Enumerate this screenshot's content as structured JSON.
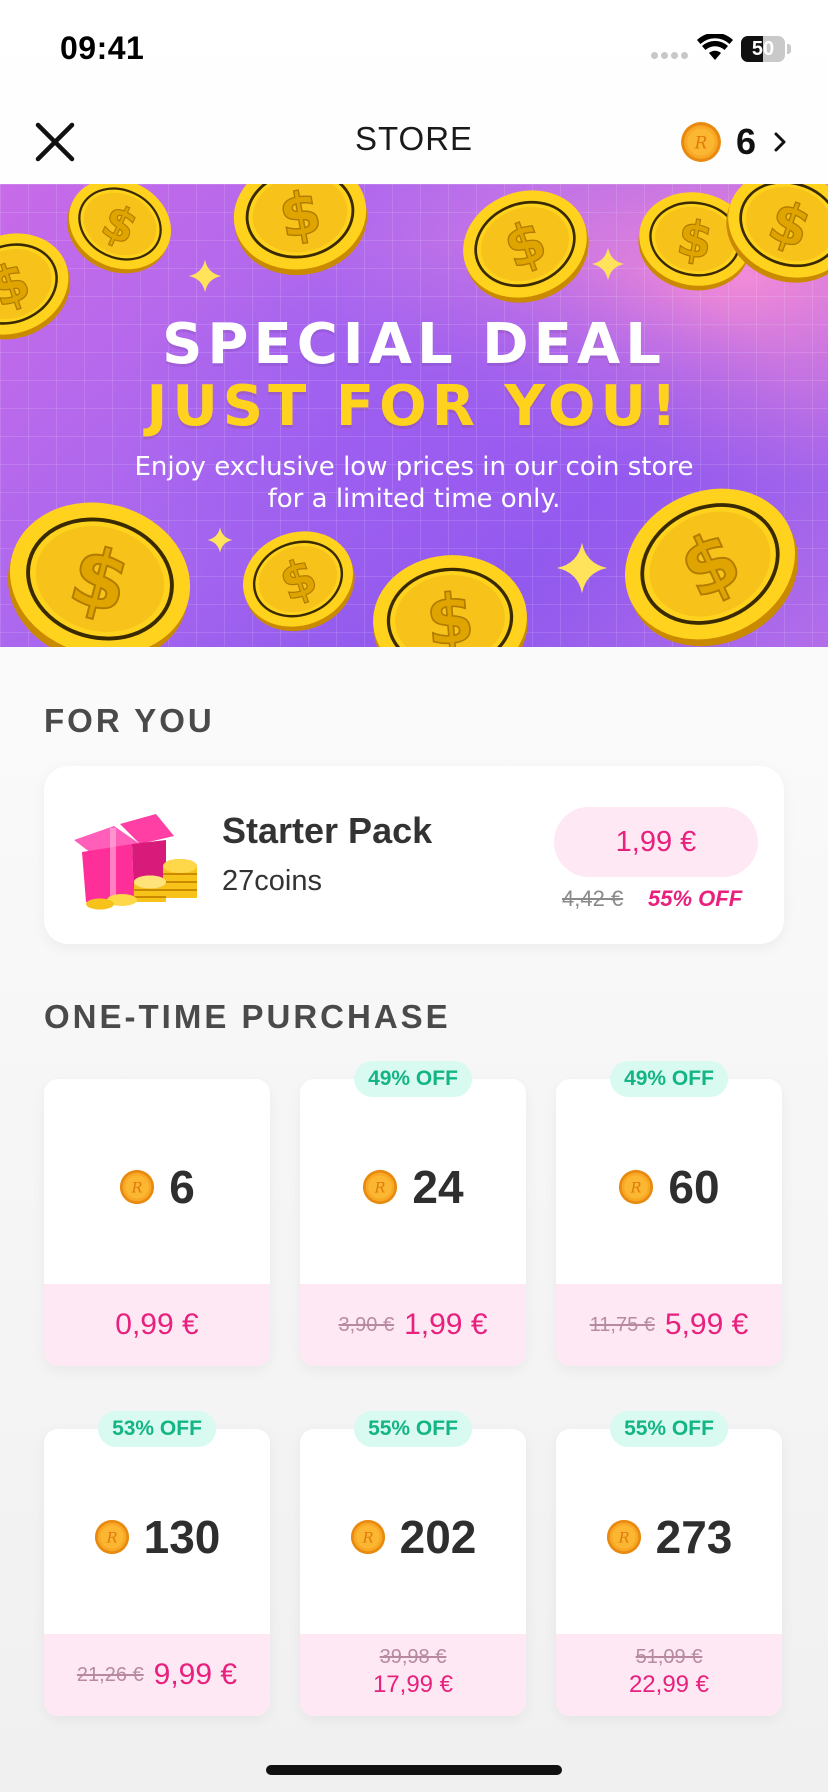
{
  "status_bar": {
    "time": "09:41",
    "battery": "50",
    "battery_level": 0.5
  },
  "header": {
    "title": "STORE",
    "balance": "6"
  },
  "banner": {
    "title_line1": "SPECIAL DEAL",
    "title_line2": "JUST FOR YOU!",
    "subtitle_line1": "Enjoy exclusive low prices in our coin store",
    "subtitle_line2": "for a limited time only."
  },
  "for_you": {
    "heading": "FOR YOU",
    "starter": {
      "name": "Starter Pack",
      "coins": "27coins",
      "price": "1,99 €",
      "old_price": "4,42 €",
      "discount": "55% OFF"
    }
  },
  "one_time": {
    "heading": "ONE-TIME PURCHASE",
    "packs": [
      {
        "amount": "6",
        "badge": "",
        "old_price": "",
        "price": "0,99 €"
      },
      {
        "amount": "24",
        "badge": "49% OFF",
        "old_price": "3,90 €",
        "price": "1,99 €"
      },
      {
        "amount": "60",
        "badge": "49% OFF",
        "old_price": "11,75 €",
        "price": "5,99 €"
      },
      {
        "amount": "130",
        "badge": "53% OFF",
        "old_price": "21,26 €",
        "price": "9,99 €"
      },
      {
        "amount": "202",
        "badge": "55% OFF",
        "old_price": "39,98 €",
        "price": "17,99 €"
      },
      {
        "amount": "273",
        "badge": "55% OFF",
        "old_price": "51,09 €",
        "price": "22,99 €"
      }
    ]
  },
  "colors": {
    "accent_pink": "#e8207e",
    "pink_bg": "#fde8f3",
    "badge_green": "#13b585",
    "badge_bg": "#d9faf0",
    "coin_gold": "#f7a81b"
  },
  "icons": {
    "close": "close-icon",
    "coin": "coin-icon",
    "chevron": "chevron-right-icon",
    "wifi": "wifi-icon",
    "gift": "gift-box-icon"
  }
}
